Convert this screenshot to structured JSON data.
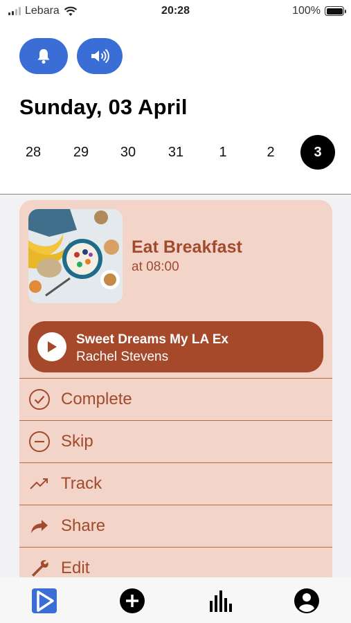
{
  "status": {
    "carrier": "Lebara",
    "time": "20:28",
    "battery": "100%"
  },
  "header": {
    "date_title": "Sunday, 03 April",
    "days": [
      "28",
      "29",
      "30",
      "31",
      "1",
      "2",
      "3"
    ],
    "selected_day": "3"
  },
  "task": {
    "title": "Eat Breakfast",
    "time": "at 08:00",
    "image": "breakfast-photo",
    "accent_color": "#a24a2c",
    "card_color": "#f3d4c9"
  },
  "player": {
    "song": "Sweet Dreams My LA Ex",
    "artist": "Rachel Stevens",
    "icon": "play-icon"
  },
  "actions": [
    {
      "label": "Complete",
      "icon": "check-circle-icon"
    },
    {
      "label": "Skip",
      "icon": "minus-circle-icon"
    },
    {
      "label": "Track",
      "icon": "trend-up-icon"
    },
    {
      "label": "Share",
      "icon": "share-arrow-icon"
    },
    {
      "label": "Edit",
      "icon": "wrench-icon"
    }
  ],
  "tabbar": {
    "tabs": [
      {
        "icon": "app-play-icon",
        "active": true
      },
      {
        "icon": "add-circle-icon",
        "active": false
      },
      {
        "icon": "stats-bars-icon",
        "active": false
      },
      {
        "icon": "profile-icon",
        "active": false
      }
    ]
  },
  "colors": {
    "primary_button": "#3a6ed6",
    "player": "#a6482a"
  }
}
